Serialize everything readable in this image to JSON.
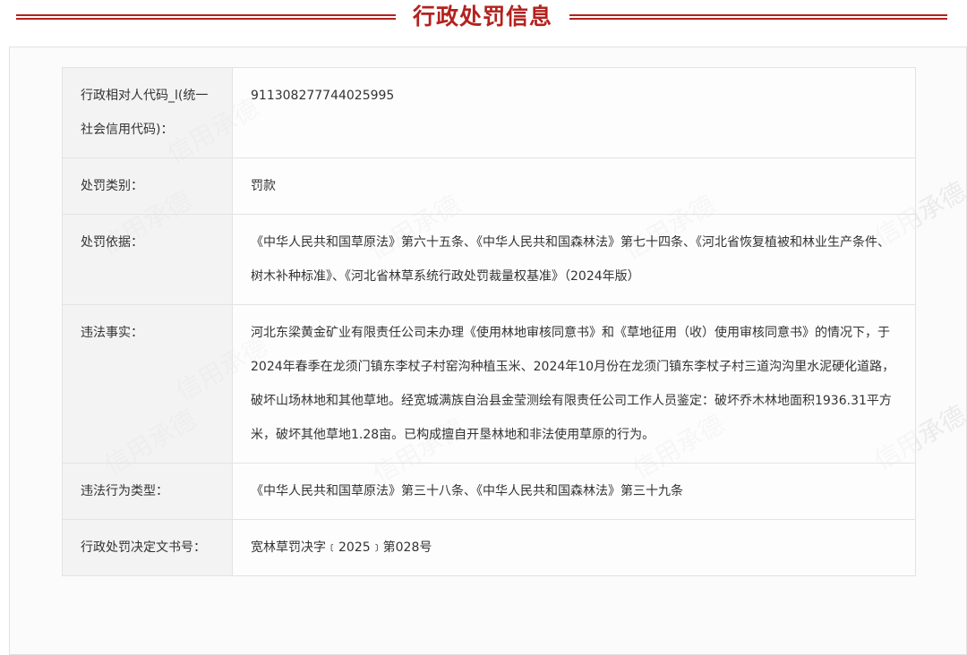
{
  "header": {
    "title": "行政处罚信息"
  },
  "watermark": {
    "text": "信用承德"
  },
  "rows": [
    {
      "label": "行政相对人代码_l(统一社会信用代码)：",
      "value": "911308277744025995"
    },
    {
      "label": "处罚类别：",
      "value": "罚款"
    },
    {
      "label": "处罚依据：",
      "value": "《中华人民共和国草原法》第六十五条、《中华人民共和国森林法》第七十四条、《河北省恢复植被和林业生产条件、树木补种标准》、《河北省林草系统行政处罚裁量权基准》（2024年版）"
    },
    {
      "label": "违法事实：",
      "value": "河北东梁黄金矿业有限责任公司未办理《使用林地审核同意书》和《草地征用（收）使用审核同意书》的情况下，于2024年春季在龙须门镇东李杖子村窑沟种植玉米、2024年10月份在龙须门镇东李杖子村三道沟沟里水泥硬化道路，破坏山场林地和其他草地。经宽城满族自治县金莹测绘有限责任公司工作人员鉴定：破坏乔木林地面积1936.31平方米，破坏其他草地1.28亩。已构成擅自开垦林地和非法使用草原的行为。"
    },
    {
      "label": "违法行为类型：",
      "value": "《中华人民共和国草原法》第三十八条、《中华人民共和国森林法》第三十九条"
    },
    {
      "label": "行政处罚决定文书号：",
      "value": "宽林草罚决字﹝2025﹞第028号"
    }
  ]
}
